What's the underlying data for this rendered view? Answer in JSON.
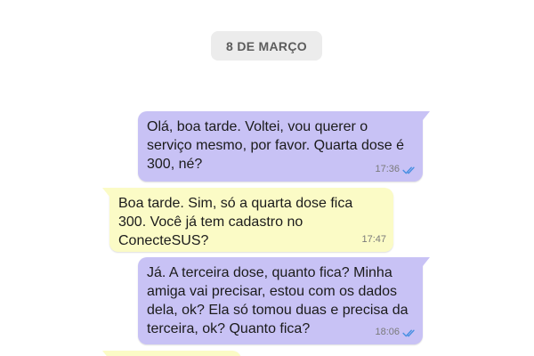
{
  "date_chip": "8 DE MARÇO",
  "messages": [
    {
      "direction": "out",
      "text": "Olá, boa tarde. Voltei, vou querer o serviço mesmo, por favor. Quarta dose é 300, né?",
      "time": "17:36",
      "status": "read"
    },
    {
      "direction": "in",
      "text": "Boa tarde. Sim, só a quarta dose fica 300. Você já tem cadastro no ConecteSUS?",
      "time": "17:47"
    },
    {
      "direction": "out",
      "text": "Já. A terceira dose, quanto fica? Minha amiga vai precisar, estou com os dados dela, ok? Ela só tomou duas e precisa da terceira, ok? Quanto fica?",
      "time": "18:06",
      "status": "read"
    },
    {
      "direction": "in",
      "text": "",
      "time": ""
    }
  ],
  "colors": {
    "outgoing_bubble": "#c8c2f5",
    "incoming_bubble": "#fbfbc6",
    "read_check": "#4a90e2",
    "date_chip_bg": "#ececec"
  }
}
